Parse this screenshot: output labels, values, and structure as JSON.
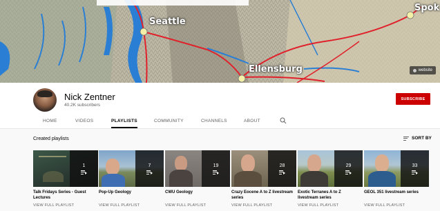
{
  "banner": {
    "map_labels": [
      "Seattle",
      "Ellensburg",
      "Spok"
    ],
    "website_label": "website"
  },
  "channel": {
    "name": "Nick Zentner",
    "subscribers": "40.2K subscribers",
    "subscribe_label": "SUBSCRIBE"
  },
  "tabs": [
    {
      "label": "HOME",
      "active": false
    },
    {
      "label": "VIDEOS",
      "active": false
    },
    {
      "label": "PLAYLISTS",
      "active": true
    },
    {
      "label": "COMMUNITY",
      "active": false
    },
    {
      "label": "CHANNELS",
      "active": false
    },
    {
      "label": "ABOUT",
      "active": false
    }
  ],
  "section": {
    "title": "Created playlists",
    "sort_label": "SORT BY"
  },
  "playlists": [
    {
      "title": "Talk Fridays Series - Guest Lectures",
      "count": "1",
      "link": "VIEW FULL PLAYLIST"
    },
    {
      "title": "Pop-Up Geology",
      "count": "7",
      "link": "VIEW FULL PLAYLIST"
    },
    {
      "title": "CWU Geology",
      "count": "19",
      "link": "VIEW FULL PLAYLIST"
    },
    {
      "title": "Crazy Eocene A to Z livestream series",
      "count": "28",
      "link": "VIEW FULL PLAYLIST"
    },
    {
      "title": "Exotic Terranes A to Z livestream series",
      "count": "29",
      "link": "VIEW FULL PLAYLIST"
    },
    {
      "title": "GEOL 351 livestream series",
      "count": "33",
      "link": "VIEW FULL PLAYLIST"
    }
  ],
  "colors": {
    "accent": "#cc0000",
    "road": "#e0202a",
    "water": "#2a7fd4"
  }
}
